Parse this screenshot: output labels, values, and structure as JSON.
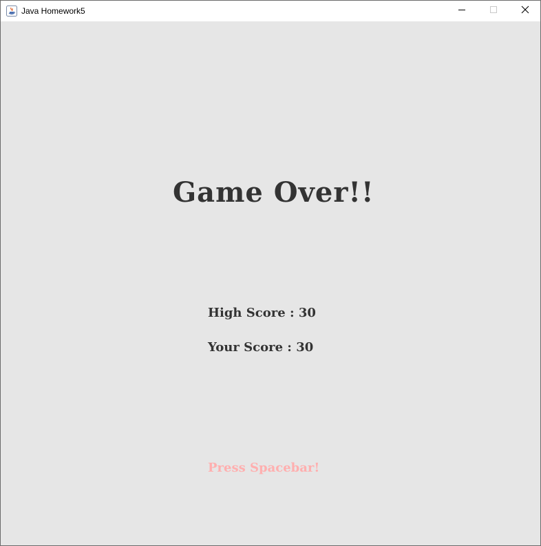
{
  "window": {
    "title": "Java Homework5",
    "controls": {
      "minimize_icon": "minimize-icon",
      "maximize_icon": "maximize-icon",
      "close_icon": "close-icon"
    }
  },
  "game": {
    "title": "Game Over!!",
    "high_score_label": "High Score",
    "high_score_value": "30",
    "your_score_label": "Your Score",
    "your_score_value": "30",
    "separator": " : ",
    "prompt": "Press Spacebar!"
  },
  "colors": {
    "background": "#e6e6e6",
    "text": "#333333",
    "prompt": "#ffafaf",
    "titlebar": "#ffffff"
  }
}
